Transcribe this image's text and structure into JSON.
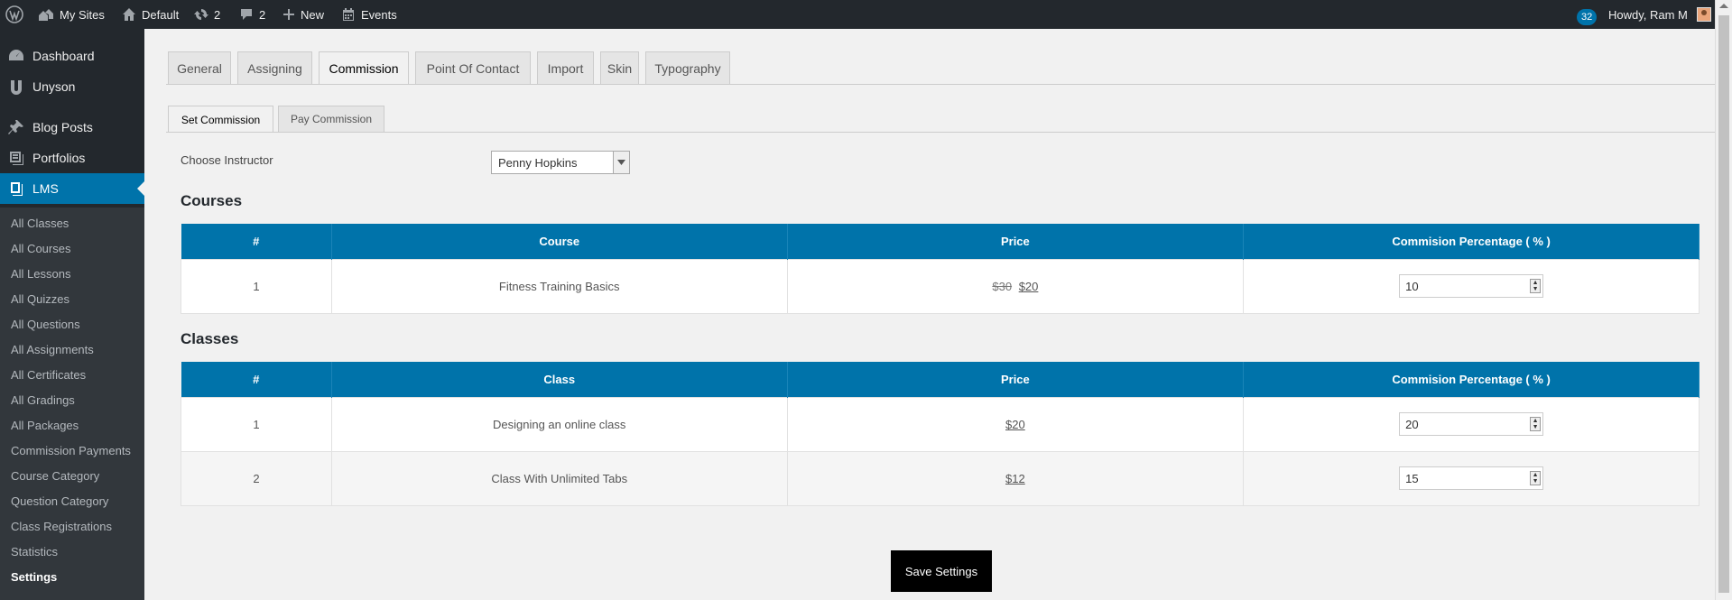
{
  "adminbar": {
    "my_sites": "My Sites",
    "site_name": "Default",
    "updates_count": "2",
    "comments_count": "2",
    "new_label": "New",
    "events_label": "Events",
    "notifications_count": "32",
    "howdy": "Howdy, Ram M"
  },
  "sidebar": {
    "items": [
      {
        "label": "Dashboard"
      },
      {
        "label": "Unyson"
      },
      {
        "label": "Blog Posts"
      },
      {
        "label": "Portfolios"
      },
      {
        "label": "LMS"
      }
    ],
    "submenu": [
      "All Classes",
      "All Courses",
      "All Lessons",
      "All Quizzes",
      "All Questions",
      "All Assignments",
      "All Certificates",
      "All Gradings",
      "All Packages",
      "Commission Payments",
      "Course Category",
      "Question Category",
      "Class Registrations",
      "Statistics",
      "Settings"
    ]
  },
  "tabs": [
    "General",
    "Assigning",
    "Commission",
    "Point Of Contact",
    "Import",
    "Skin",
    "Typography"
  ],
  "subtabs": [
    "Set Commission",
    "Pay Commission"
  ],
  "form": {
    "instructor_label": "Choose Instructor",
    "instructor_value": "Penny Hopkins"
  },
  "courses": {
    "title": "Courses",
    "headers": [
      "#",
      "Course",
      "Price",
      "Commision Percentage ( % )"
    ],
    "rows": [
      {
        "num": "1",
        "name": "Fitness Training Basics",
        "old_price": "$30",
        "price": "$20",
        "percent": "10"
      }
    ]
  },
  "classes": {
    "title": "Classes",
    "headers": [
      "#",
      "Class",
      "Price",
      "Commision Percentage ( % )"
    ],
    "rows": [
      {
        "num": "1",
        "name": "Designing an online class",
        "price": "$20",
        "percent": "20"
      },
      {
        "num": "2",
        "name": "Class With Unlimited Tabs",
        "price": "$12",
        "percent": "15"
      }
    ]
  },
  "save_label": "Save Settings",
  "colors": {
    "accent": "#0073aa",
    "adminbar": "#23282d",
    "submenu": "#32373c"
  }
}
